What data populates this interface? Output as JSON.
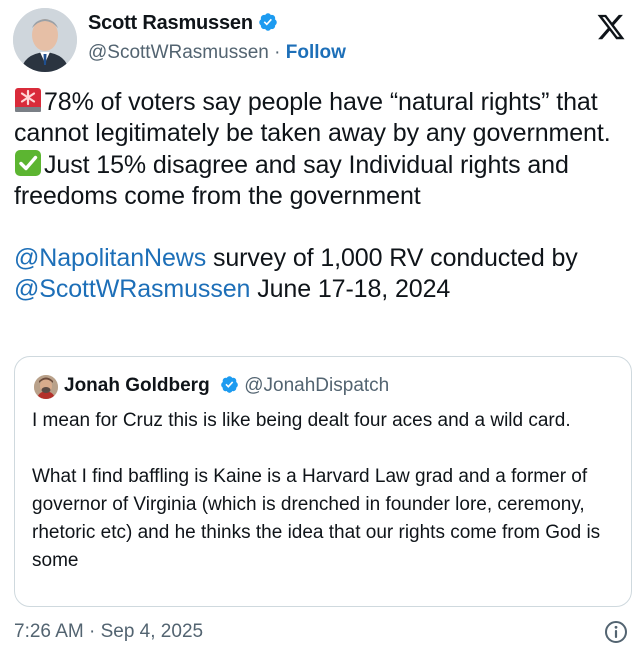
{
  "author": {
    "name": "Scott Rasmussen",
    "handle": "@ScottWRasmussen",
    "separator": "·",
    "follow_label": "Follow",
    "verified_color": "#1d9bf0"
  },
  "platform_icon": "x-logo-icon",
  "post": {
    "line1": "78% of voters say people have “natural rights” that cannot legitimately be taken away by any government.",
    "line1_emoji": "siren-icon",
    "line2": "Just 15% disagree and say Individual rights and freedoms come from the government",
    "line2_emoji": "check-mark-button-icon",
    "mention1": "@NapolitanNews",
    "text1": " survey of 1,000 RV conducted by ",
    "mention2": "@ScottWRasmussen",
    "text2": " June 17-18, 2024"
  },
  "quoted": {
    "name": "Jonah Goldberg",
    "handle": "@JonahDispatch",
    "paragraph1": "I mean for Cruz this is like being dealt four aces and a wild card.",
    "paragraph2": "What I find baffling is Kaine is a Harvard Law grad and a former of governor of Virginia (which is drenched in founder lore, ceremony, rhetoric etc) and he thinks the idea that our rights come from God is some"
  },
  "timestamp": "7:26 AM · Sep 4, 2025",
  "colors": {
    "link": "#1d6fb8",
    "secondary_text": "#536471",
    "border": "#cfd9de"
  }
}
